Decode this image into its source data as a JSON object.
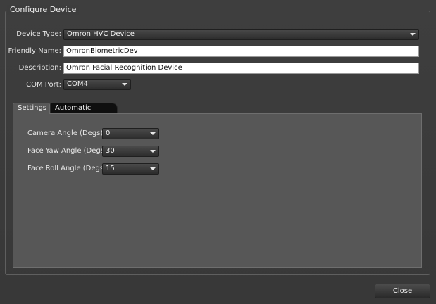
{
  "group": {
    "title": "Configure Device"
  },
  "form": {
    "device_type": {
      "label": "Device Type:",
      "value": "Omron HVC Device"
    },
    "friendly_name": {
      "label": "Friendly Name:",
      "value": "OmronBiometricDev"
    },
    "description": {
      "label": "Description:",
      "value": "Omron Facial Recognition Device"
    },
    "com_port": {
      "label": "COM Port:",
      "value": "COM4"
    }
  },
  "tabs": [
    {
      "label": "Settings",
      "selected": true
    },
    {
      "label": "Automatic Actions",
      "selected": false
    }
  ],
  "settings": {
    "camera_angle": {
      "label": "Camera Angle (Degs):",
      "value": "0"
    },
    "face_yaw": {
      "label": "Face Yaw Angle (Degs):",
      "value": "30"
    },
    "face_roll": {
      "label": "Face Roll Angle (Degs):",
      "value": "15"
    }
  },
  "footer": {
    "close_label": "Close"
  },
  "icons": {
    "dropdown": "chevron-down-icon"
  },
  "colors": {
    "background": "#3b3b3b",
    "panel": "#575757",
    "active_tab": "#575757",
    "inactive_tab": "#0f0f0f",
    "input_bg": "#ffffff"
  }
}
